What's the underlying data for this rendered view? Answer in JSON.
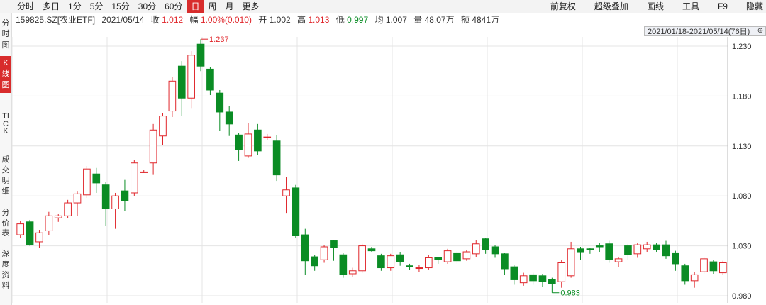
{
  "toolbar": {
    "tabs": [
      "分时",
      "多日",
      "1分",
      "5分",
      "15分",
      "30分",
      "60分",
      "日",
      "周",
      "月",
      "更多"
    ],
    "active_tab": "日",
    "right": [
      "前复权",
      "超级叠加",
      "画线",
      "工具",
      "F9",
      "隐藏"
    ]
  },
  "info": {
    "code": "159825.SZ[农业ETF]",
    "date": "2021/05/14",
    "close_label": "收",
    "close": "1.012",
    "change_label": "幅",
    "change": "1.00%(0.010)",
    "open_label": "开",
    "open": "1.002",
    "high_label": "高",
    "high": "1.013",
    "low_label": "低",
    "low": "0.997",
    "avg_label": "均",
    "avg": "1.007",
    "volume_label": "量",
    "volume": "48.07万",
    "amount_label": "额",
    "amount": "4841万"
  },
  "side_nav": [
    {
      "label": "分时图",
      "active": false
    },
    {
      "label": "K线图",
      "active": true
    },
    {
      "label": "TICK",
      "active": false
    },
    {
      "label": "成交明细",
      "active": false
    },
    {
      "label": "分价表",
      "active": false
    },
    {
      "label": "深度资料",
      "active": false
    }
  ],
  "range_label": "2021/01/18-2021/05/14(76日)",
  "range_button": "⊕",
  "colors": {
    "up": "#e0262b",
    "down": "#0a8c24",
    "grid": "#e4e4e4",
    "active": "#d82c2c"
  },
  "chart_data": {
    "type": "candlestick",
    "ylim": [
      0.975,
      1.235
    ],
    "yticks": [
      "1.230",
      "1.180",
      "1.130",
      "1.080",
      "1.030",
      "0.980"
    ],
    "annotations": [
      {
        "label": "1.237",
        "index": 19,
        "value": 1.237,
        "color": "#e0262b"
      },
      {
        "label": "0.983",
        "index": 56,
        "value": 0.983,
        "color": "#0a8c24"
      }
    ],
    "candles": [
      [
        1.041,
        1.052,
        1.038,
        1.055
      ],
      [
        1.054,
        1.031,
        1.03,
        1.056
      ],
      [
        1.034,
        1.043,
        1.028,
        1.046
      ],
      [
        1.045,
        1.06,
        1.041,
        1.064
      ],
      [
        1.058,
        1.06,
        1.054,
        1.062
      ],
      [
        1.06,
        1.073,
        1.058,
        1.076
      ],
      [
        1.073,
        1.082,
        1.06,
        1.085
      ],
      [
        1.081,
        1.107,
        1.078,
        1.11
      ],
      [
        1.102,
        1.093,
        1.083,
        1.108
      ],
      [
        1.091,
        1.067,
        1.05,
        1.094
      ],
      [
        1.067,
        1.08,
        1.047,
        1.083
      ],
      [
        1.085,
        1.075,
        1.065,
        1.096
      ],
      [
        1.083,
        1.113,
        1.08,
        1.116
      ],
      [
        1.104,
        1.104,
        1.103,
        1.106
      ],
      [
        1.113,
        1.146,
        1.101,
        1.152
      ],
      [
        1.14,
        1.16,
        1.131,
        1.163
      ],
      [
        1.165,
        1.195,
        1.159,
        1.199
      ],
      [
        1.21,
        1.178,
        1.16,
        1.215
      ],
      [
        1.178,
        1.221,
        1.168,
        1.225
      ],
      [
        1.232,
        1.21,
        1.205,
        1.237
      ],
      [
        1.207,
        1.186,
        1.181,
        1.209
      ],
      [
        1.183,
        1.164,
        1.145,
        1.186
      ],
      [
        1.164,
        1.152,
        1.14,
        1.17
      ],
      [
        1.141,
        1.126,
        1.115,
        1.143
      ],
      [
        1.12,
        1.142,
        1.118,
        1.153
      ],
      [
        1.146,
        1.125,
        1.121,
        1.152
      ],
      [
        1.139,
        1.139,
        1.136,
        1.142
      ],
      [
        1.135,
        1.101,
        1.095,
        1.141
      ],
      [
        1.08,
        1.086,
        1.063,
        1.099
      ],
      [
        1.088,
        1.04,
        1.038,
        1.091
      ],
      [
        1.041,
        1.015,
        1.001,
        1.047
      ],
      [
        1.019,
        1.01,
        1.005,
        1.021
      ],
      [
        1.016,
        1.029,
        1.013,
        1.031
      ],
      [
        1.035,
        1.028,
        1.015,
        1.036
      ],
      [
        1.021,
        1.001,
        0.998,
        1.023
      ],
      [
        1.002,
        1.005,
        0.999,
        1.008
      ],
      [
        1.005,
        1.03,
        1.003,
        1.032
      ],
      [
        1.027,
        1.025,
        1.024,
        1.029
      ],
      [
        1.02,
        1.008,
        1.005,
        1.022
      ],
      [
        1.008,
        1.02,
        1.005,
        1.022
      ],
      [
        1.021,
        1.014,
        1.01,
        1.024
      ],
      [
        1.01,
        1.009,
        1.006,
        1.012
      ],
      [
        1.008,
        1.008,
        1.004,
        1.011
      ],
      [
        1.008,
        1.018,
        1.006,
        1.021
      ],
      [
        1.018,
        1.016,
        1.012,
        1.019
      ],
      [
        1.014,
        1.025,
        1.012,
        1.027
      ],
      [
        1.023,
        1.015,
        1.012,
        1.025
      ],
      [
        1.017,
        1.024,
        1.015,
        1.026
      ],
      [
        1.022,
        1.032,
        1.019,
        1.036
      ],
      [
        1.037,
        1.026,
        1.022,
        1.038
      ],
      [
        1.029,
        1.022,
        1.018,
        1.031
      ],
      [
        1.022,
        1.007,
        1.001,
        1.023
      ],
      [
        1.009,
        0.996,
        0.991,
        1.011
      ],
      [
        0.993,
        1.0,
        0.99,
        1.003
      ],
      [
        1.001,
        0.995,
        0.991,
        1.003
      ],
      [
        1.0,
        0.994,
        0.989,
        1.002
      ],
      [
        0.996,
        0.992,
        0.983,
        0.998
      ],
      [
        0.994,
        1.013,
        0.988,
        1.016
      ],
      [
        1.0,
        1.027,
        0.998,
        1.034
      ],
      [
        1.027,
        1.024,
        1.016,
        1.029
      ],
      [
        1.027,
        1.026,
        1.022,
        1.028
      ],
      [
        1.03,
        1.029,
        1.024,
        1.033
      ],
      [
        1.032,
        1.016,
        1.013,
        1.035
      ],
      [
        1.014,
        1.017,
        1.009,
        1.019
      ],
      [
        1.03,
        1.021,
        1.016,
        1.032
      ],
      [
        1.022,
        1.031,
        1.018,
        1.033
      ],
      [
        1.027,
        1.031,
        1.024,
        1.034
      ],
      [
        1.031,
        1.026,
        1.024,
        1.033
      ],
      [
        1.031,
        1.02,
        1.017,
        1.035
      ],
      [
        1.023,
        1.012,
        1.005,
        1.025
      ],
      [
        1.01,
        0.995,
        0.991,
        1.012
      ],
      [
        0.995,
        1.001,
        0.988,
        1.004
      ],
      [
        1.004,
        1.017,
        1.002,
        1.019
      ],
      [
        1.014,
        1.005,
        1.002,
        1.016
      ],
      [
        1.003,
        1.013,
        1.001,
        1.015
      ]
    ]
  }
}
